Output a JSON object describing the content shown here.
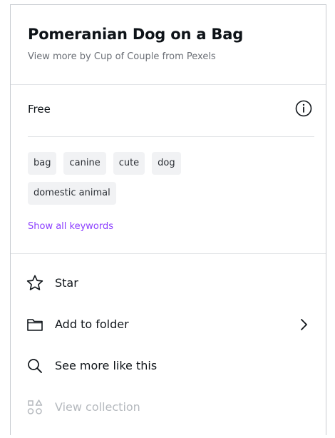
{
  "header": {
    "title": "Pomeranian Dog on a Bag",
    "subtitle": "View more by Cup of Couple from Pexels"
  },
  "license": {
    "label": "Free",
    "info_icon": "info-icon"
  },
  "keywords": {
    "chips": [
      "bag",
      "canine",
      "cute",
      "dog",
      "domestic animal"
    ],
    "show_all_label": "Show all keywords"
  },
  "actions": [
    {
      "label": "Star",
      "icon": "star-icon",
      "enabled": true
    },
    {
      "label": "Add to folder",
      "icon": "folder-icon",
      "enabled": true,
      "has_submenu": true
    },
    {
      "label": "See more like this",
      "icon": "search-icon",
      "enabled": true
    },
    {
      "label": "View collection",
      "icon": "collection-icon",
      "enabled": false
    }
  ],
  "colors": {
    "accent": "#8b3dff",
    "text": "#0e1318",
    "muted": "#6b6f76",
    "disabled": "#b5b9be",
    "chip_bg": "#f1f2f4"
  }
}
